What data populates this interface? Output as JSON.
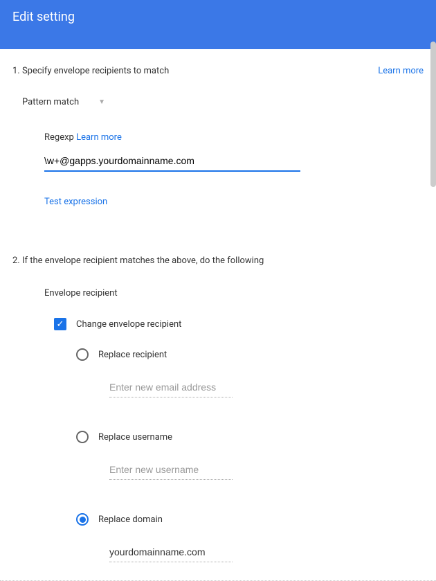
{
  "header": {
    "title": "Edit setting"
  },
  "section1": {
    "title": "1. Specify envelope recipients to match",
    "learn_more": "Learn more",
    "dropdown": {
      "selected": "Pattern match"
    },
    "regexp": {
      "label": "Regexp",
      "learn_more": "Learn more",
      "value": "\\w+@gapps.yourdomainname.com",
      "test_link": "Test expression"
    }
  },
  "section2": {
    "title": "2. If the envelope recipient matches the above, do the following",
    "envelope_label": "Envelope recipient",
    "change_checkbox": {
      "label": "Change envelope recipient",
      "checked": true
    },
    "options": {
      "replace_recipient": {
        "label": "Replace recipient",
        "placeholder": "Enter new email address",
        "value": ""
      },
      "replace_username": {
        "label": "Replace username",
        "placeholder": "Enter new username",
        "value": ""
      },
      "replace_domain": {
        "label": "Replace domain",
        "value": "yourdomainname.com"
      }
    }
  }
}
